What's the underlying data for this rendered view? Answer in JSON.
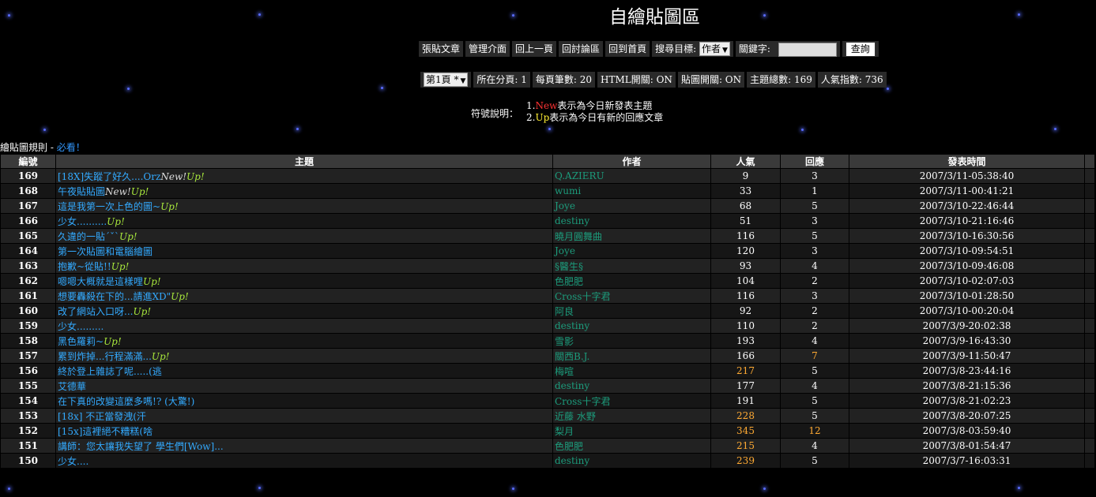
{
  "page_title": "自繪貼圖區",
  "toolbar": {
    "buttons": [
      "張貼文章",
      "管理介面",
      "回上一頁",
      "回討論區",
      "回到首頁"
    ],
    "search_label": "搜尋目標:",
    "search_target": "作者",
    "keyword_label": "關鍵字:",
    "keyword_value": "",
    "query_button": "查詢"
  },
  "info_bar": {
    "page_select": "第1頁 *",
    "items": [
      "所在分頁: 1",
      "每頁筆數: 20",
      "HTML開關: ON",
      "貼圖開關: ON",
      "主題總數: 169",
      "人氣指數: 736"
    ]
  },
  "legend": {
    "title": "符號說明：",
    "line1_prefix": "1.",
    "line1_tag": "New",
    "line1_text": "表示為今日新發表主題",
    "line2_prefix": "2.",
    "line2_tag": "Up",
    "line2_text": "表示為今日有新的回應文章"
  },
  "rule_notice": {
    "text": "繪貼圖規則 - ",
    "link": "必看！"
  },
  "table": {
    "headers": [
      "編號",
      "主題",
      "作者",
      "人氣",
      "回應",
      "發表時間"
    ],
    "rows": [
      {
        "no": "169",
        "topic": "[18X]失蹤了好久....Orz",
        "new": "New!",
        "up": "Up!",
        "author": "Q.AZIERU",
        "pop": "9",
        "rep": "3",
        "time": "2007/3/11-05:38:40"
      },
      {
        "no": "168",
        "topic": "午夜貼貼圖",
        "new": "New!",
        "up": "Up!",
        "author": "wumi",
        "pop": "33",
        "rep": "1",
        "time": "2007/3/11-00:41:21"
      },
      {
        "no": "167",
        "topic": "這是我第一次上色的圖~",
        "new": "",
        "up": "Up!",
        "author": "Joye",
        "pop": "68",
        "rep": "5",
        "time": "2007/3/10-22:46:44"
      },
      {
        "no": "166",
        "topic": "少女..........",
        "new": "",
        "up": "Up!",
        "author": "destiny",
        "pop": "51",
        "rep": "3",
        "time": "2007/3/10-21:16:46"
      },
      {
        "no": "165",
        "topic": "久違的一貼ˊˇˋ",
        "new": "",
        "up": "Up!",
        "author": "曉月圓舞曲",
        "pop": "116",
        "rep": "5",
        "time": "2007/3/10-16:30:56"
      },
      {
        "no": "164",
        "topic": "第一次貼圖和電腦繪圖",
        "new": "",
        "up": "",
        "author": "Joye",
        "pop": "120",
        "rep": "3",
        "time": "2007/3/10-09:54:51"
      },
      {
        "no": "163",
        "topic": "抱歉~從貼!!",
        "new": "",
        "up": "Up!",
        "author": "§醫生§",
        "pop": "93",
        "rep": "4",
        "time": "2007/3/10-09:46:08"
      },
      {
        "no": "162",
        "topic": "嗯嗯大概就是這樣哩",
        "new": "",
        "up": "Up!",
        "author": "色肥肥",
        "pop": "104",
        "rep": "2",
        "time": "2007/3/10-02:07:03"
      },
      {
        "no": "161",
        "topic": "想要轟殺在下的...請進XD\"",
        "new": "",
        "up": "Up!",
        "author": "Cross十字君",
        "pop": "116",
        "rep": "3",
        "time": "2007/3/10-01:28:50"
      },
      {
        "no": "160",
        "topic": "改了網站入口呀...",
        "new": "",
        "up": "Up!",
        "author": "阿良",
        "pop": "92",
        "rep": "2",
        "time": "2007/3/10-00:20:04"
      },
      {
        "no": "159",
        "topic": "少女.........",
        "new": "",
        "up": "",
        "author": "destiny",
        "pop": "110",
        "rep": "2",
        "time": "2007/3/9-20:02:38"
      },
      {
        "no": "158",
        "topic": "黑色羅莉~",
        "new": "",
        "up": "Up!",
        "author": "雪影",
        "pop": "193",
        "rep": "4",
        "time": "2007/3/9-16:43:30"
      },
      {
        "no": "157",
        "topic": "累到炸掉...行程滿滿...",
        "new": "",
        "up": "Up!",
        "author": "關西B.J.",
        "pop": "166",
        "rep": "7",
        "time": "2007/3/9-11:50:47"
      },
      {
        "no": "156",
        "topic": "終於登上雜誌了呢.....(逃",
        "new": "",
        "up": "",
        "author": "梅喧",
        "pop": "217",
        "rep": "5",
        "time": "2007/3/8-23:44:16"
      },
      {
        "no": "155",
        "topic": "艾德華",
        "new": "",
        "up": "",
        "author": "destiny",
        "pop": "177",
        "rep": "4",
        "time": "2007/3/8-21:15:36"
      },
      {
        "no": "154",
        "topic": "在下真的改變這麼多嗎!? (大驚!)",
        "new": "",
        "up": "",
        "author": "Cross十字君",
        "pop": "191",
        "rep": "5",
        "time": "2007/3/8-21:02:23"
      },
      {
        "no": "153",
        "topic": "[18x] 不正當發洩(汗",
        "new": "",
        "up": "",
        "author": "近藤 水野",
        "pop": "228",
        "rep": "5",
        "time": "2007/3/8-20:07:25"
      },
      {
        "no": "152",
        "topic": "[15x]這裡絕不糟糕(啥",
        "new": "",
        "up": "",
        "author": "梨月",
        "pop": "345",
        "rep": "12",
        "time": "2007/3/8-03:59:40"
      },
      {
        "no": "151",
        "topic": "講師：您太讓我失望了 學生們[Wow]...",
        "new": "",
        "up": "",
        "author": "色肥肥",
        "pop": "215",
        "rep": "4",
        "time": "2007/3/8-01:54:47"
      },
      {
        "no": "150",
        "topic": "少女....",
        "new": "",
        "up": "",
        "author": "destiny",
        "pop": "239",
        "rep": "5",
        "time": "2007/3/7-16:03:31"
      }
    ]
  },
  "colors": {
    "hot": "#ffaa33",
    "topic_link": "#33aaff",
    "author_link": "#1c9c7c",
    "up_tag": "#a8e83c",
    "new_tag": "#ff3333"
  }
}
